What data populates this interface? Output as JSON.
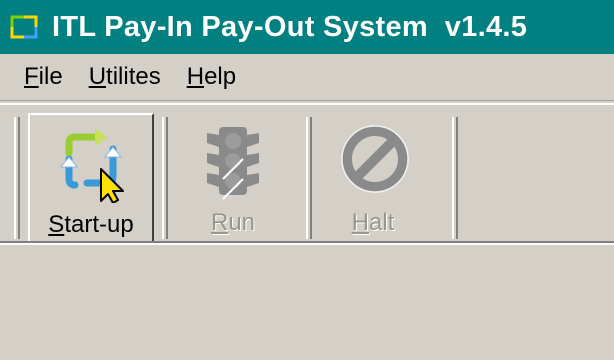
{
  "window": {
    "title": "ITL Pay-In Pay-Out System  v1.4.5",
    "title_bar_color": "#008080"
  },
  "menu": [
    {
      "first": "F",
      "rest": "ile"
    },
    {
      "first": "U",
      "rest": "tilites"
    },
    {
      "first": "H",
      "rest": "elp"
    }
  ],
  "toolbar": {
    "startup": {
      "first": "S",
      "rest": "tart-up",
      "icon": "refresh-cycle-icon",
      "state": "pressed"
    },
    "run": {
      "first": "R",
      "rest": "un",
      "icon": "traffic-light-icon",
      "state": "disabled"
    },
    "halt": {
      "first": "H",
      "rest": "alt",
      "icon": "prohibited-icon",
      "state": "disabled"
    }
  }
}
